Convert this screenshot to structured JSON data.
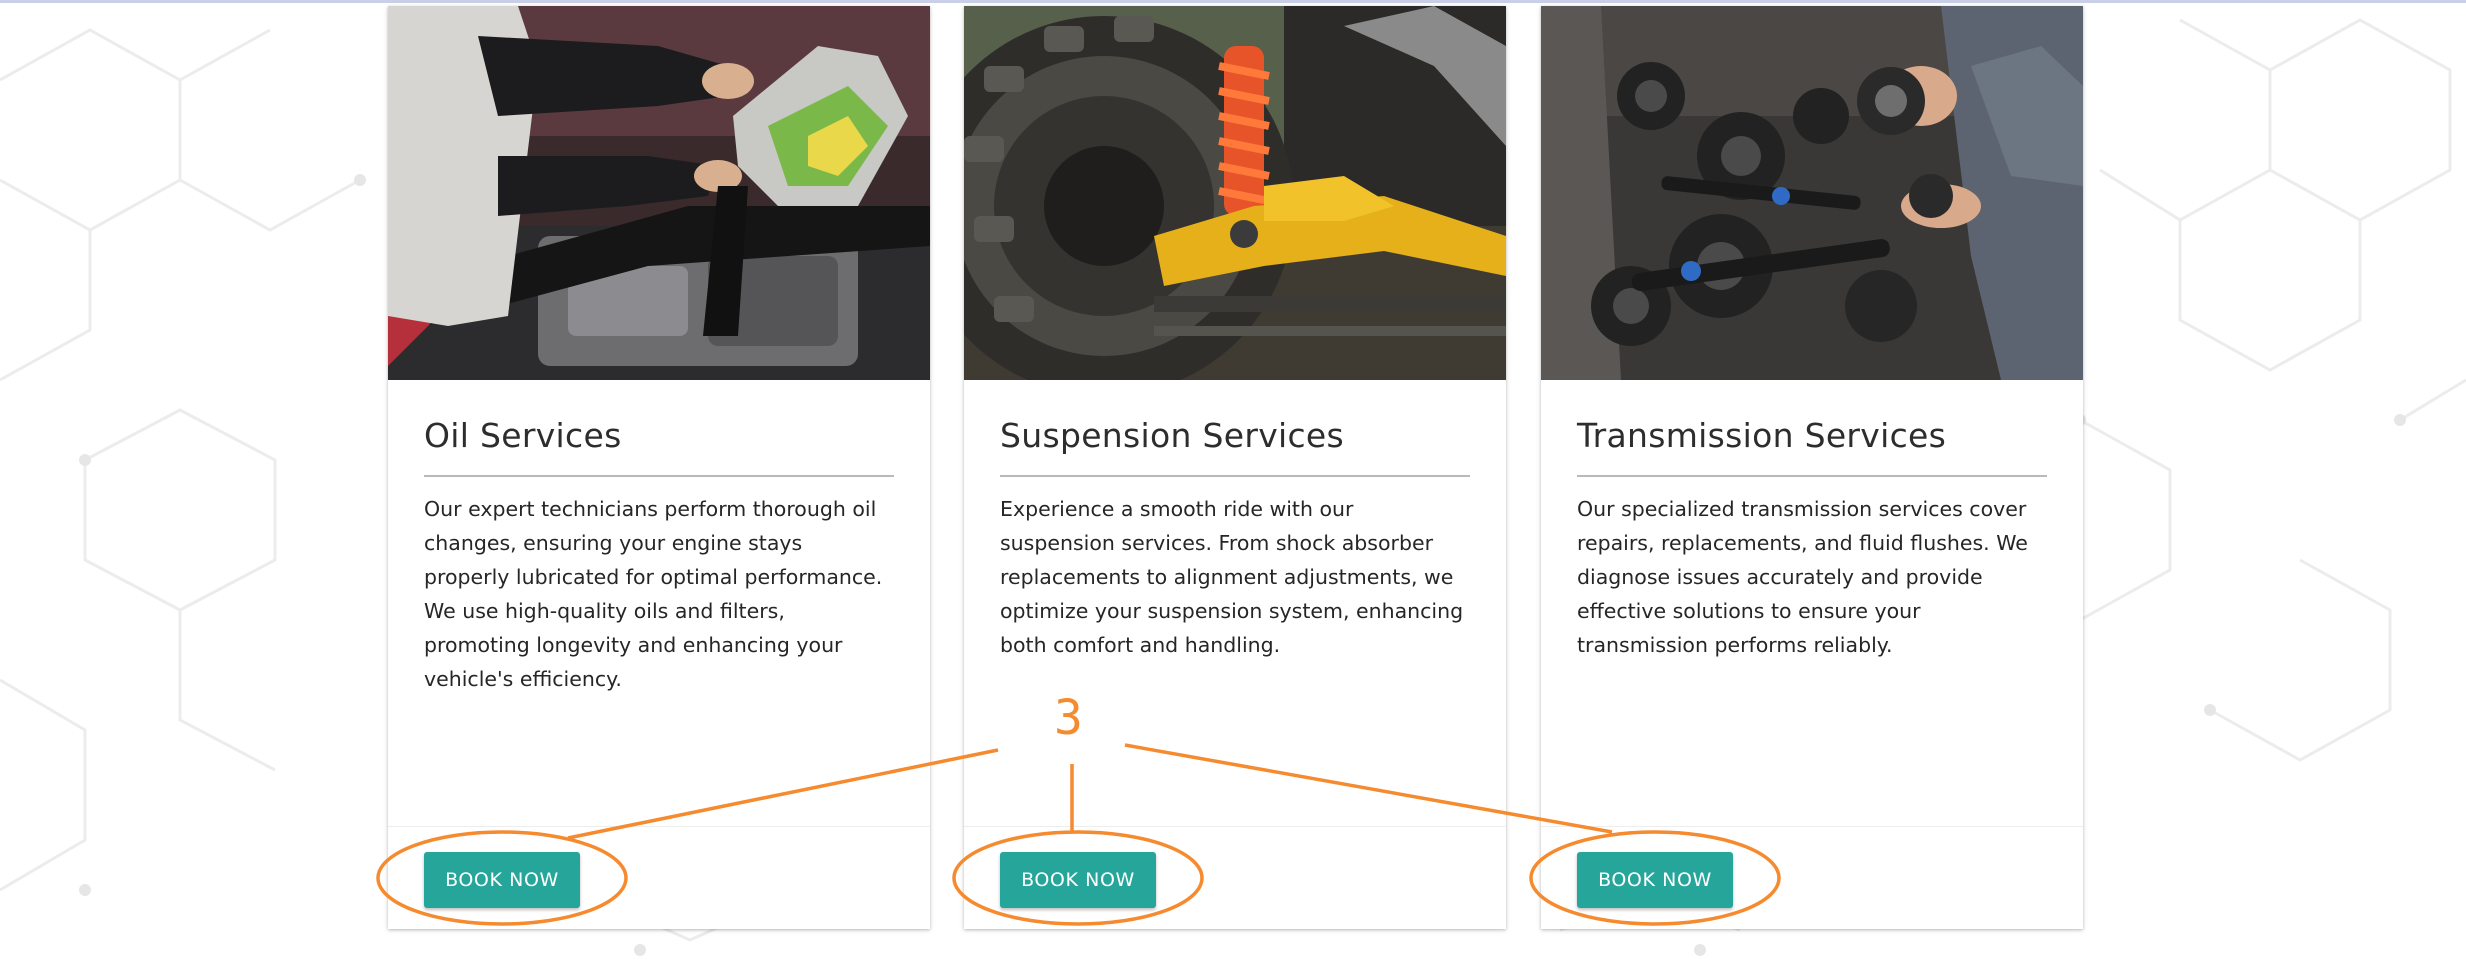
{
  "cards": [
    {
      "image_alt": "Technician pouring motor oil into a car engine",
      "title": "Oil Services",
      "description": "Our expert technicians perform thorough oil changes, ensuring your engine stays properly lubricated for optimal performance. We use high-quality oils and filters, promoting longevity and enhancing your vehicle's efficiency.",
      "button_label": "BOOK NOW"
    },
    {
      "image_alt": "Off-road tire with orange coil-over shock and yellow control arm",
      "title": "Suspension Services",
      "description": "Experience a smooth ride with our suspension services. From shock absorber replacements to alignment adjustments, we optimize your suspension system, enhancing both comfort and handling.",
      "button_label": "BOOK NOW"
    },
    {
      "image_alt": "Mechanic holding transmission gears over a workbench of gear parts",
      "title": "Transmission Services",
      "description": "Our specialized transmission services cover repairs, replacements, and fluid flushes. We diagnose issues accurately and provide effective solutions to ensure your transmission performs reliably.",
      "button_label": "BOOK NOW"
    }
  ],
  "annotation": {
    "label": "3",
    "color": "#f58a2e"
  },
  "colors": {
    "button": "#26a69a",
    "annotation": "#f58a2e",
    "top_border": "#c9cfe6"
  }
}
